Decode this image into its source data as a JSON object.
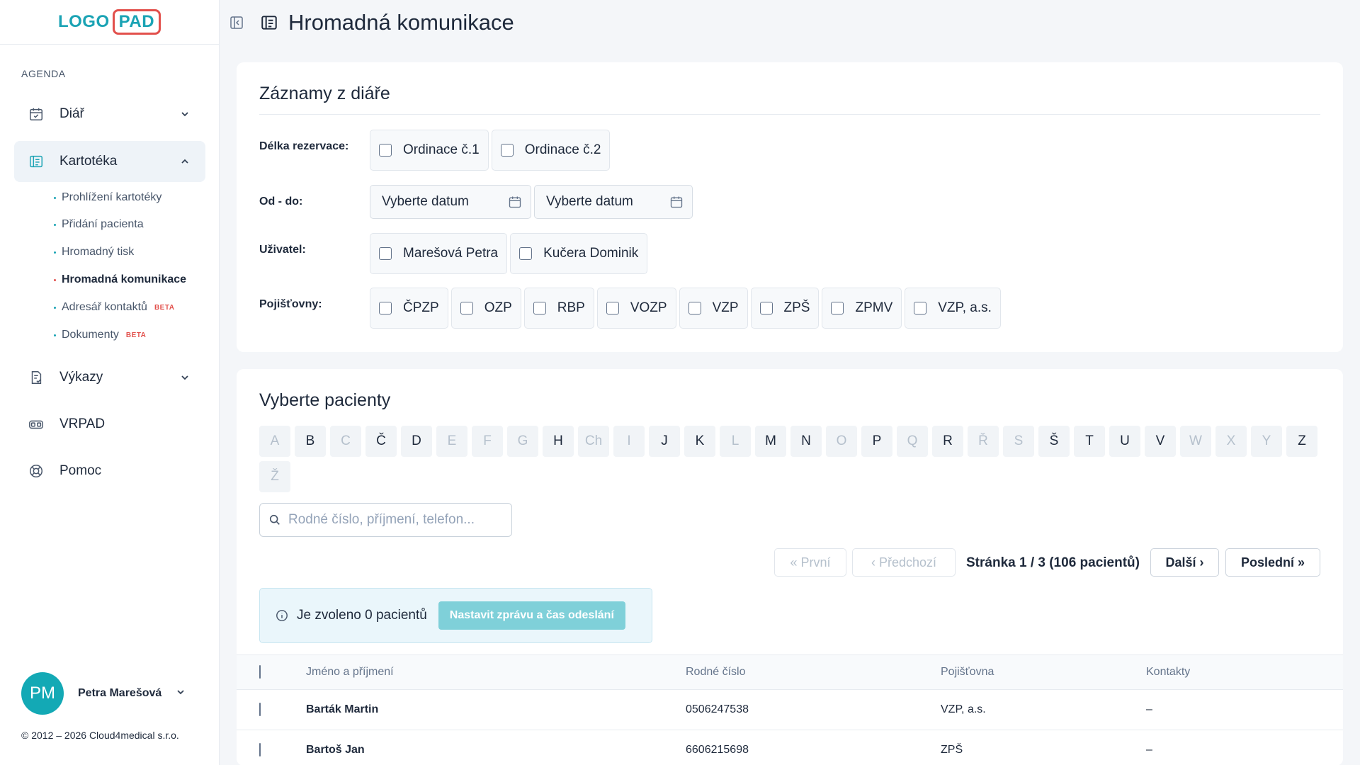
{
  "logo": {
    "part1": "LOGO",
    "part2": "PAD"
  },
  "sidebar": {
    "section": "AGENDA",
    "items": [
      {
        "label": "Diář",
        "icon": "calendar-icon"
      },
      {
        "label": "Kartotéka",
        "icon": "cards-icon"
      },
      {
        "label": "Výkazy",
        "icon": "report-icon"
      },
      {
        "label": "VRPAD",
        "icon": "vr-icon"
      },
      {
        "label": "Pomoc",
        "icon": "help-icon"
      }
    ],
    "subitems": [
      {
        "label": "Prohlížení kartotéky"
      },
      {
        "label": "Přidání pacienta"
      },
      {
        "label": "Hromadný tisk"
      },
      {
        "label": "Hromadná komunikace"
      },
      {
        "label": "Adresář kontaktů",
        "badge": "BETA"
      },
      {
        "label": "Dokumenty",
        "badge": "BETA"
      }
    ]
  },
  "user": {
    "initials": "PM",
    "name": "Petra Marešová"
  },
  "copyright": "© 2012 – 2026 Cloud4medical s.r.o.",
  "header": {
    "title": "Hromadná komunikace"
  },
  "records": {
    "title": "Záznamy z diáře",
    "length_label": "Délka rezervace:",
    "rooms": [
      "Ordinace č.1",
      "Ordinace č.2"
    ],
    "range_label": "Od - do:",
    "date_from_placeholder": "Vyberte datum",
    "date_to_placeholder": "Vyberte datum",
    "user_label": "Uživatel:",
    "users": [
      "Marešová Petra",
      "Kučera Dominik"
    ],
    "insurance_label": "Pojišťovny:",
    "insurances": [
      "ČPZP",
      "OZP",
      "RBP",
      "VOZP",
      "VZP",
      "ZPŠ",
      "ZPMV",
      "VZP, a.s."
    ]
  },
  "patients": {
    "title": "Vyberte pacienty",
    "letters": [
      {
        "l": "A",
        "enabled": false
      },
      {
        "l": "B",
        "enabled": true
      },
      {
        "l": "C",
        "enabled": false
      },
      {
        "l": "Č",
        "enabled": true
      },
      {
        "l": "D",
        "enabled": true
      },
      {
        "l": "E",
        "enabled": false
      },
      {
        "l": "F",
        "enabled": false
      },
      {
        "l": "G",
        "enabled": false
      },
      {
        "l": "H",
        "enabled": true
      },
      {
        "l": "Ch",
        "enabled": false
      },
      {
        "l": "I",
        "enabled": false
      },
      {
        "l": "J",
        "enabled": true
      },
      {
        "l": "K",
        "enabled": true
      },
      {
        "l": "L",
        "enabled": false
      },
      {
        "l": "M",
        "enabled": true
      },
      {
        "l": "N",
        "enabled": true
      },
      {
        "l": "O",
        "enabled": false
      },
      {
        "l": "P",
        "enabled": true
      },
      {
        "l": "Q",
        "enabled": false
      },
      {
        "l": "R",
        "enabled": true
      },
      {
        "l": "Ř",
        "enabled": false
      },
      {
        "l": "S",
        "enabled": false
      },
      {
        "l": "Š",
        "enabled": true
      },
      {
        "l": "T",
        "enabled": true
      },
      {
        "l": "U",
        "enabled": true
      },
      {
        "l": "V",
        "enabled": true
      },
      {
        "l": "W",
        "enabled": false
      },
      {
        "l": "X",
        "enabled": false
      },
      {
        "l": "Y",
        "enabled": false
      },
      {
        "l": "Z",
        "enabled": true
      },
      {
        "l": "Ž",
        "enabled": false
      }
    ],
    "search_placeholder": "Rodné číslo, příjmení, telefon...",
    "pager": {
      "first": "« První",
      "prev": "‹ Předchozí",
      "info": "Stránka 1 / 3 (106 pacientů)",
      "next": "Další ›",
      "last": "Poslední »"
    },
    "selected_info": "Je zvoleno 0 pacientů",
    "set_message_button": "Nastavit zprávu a čas odeslání",
    "columns": [
      "Jméno a příjmení",
      "Rodné číslo",
      "Pojišťovna",
      "Kontakty"
    ],
    "rows": [
      {
        "name": "Barták Martin",
        "rc": "0506247538",
        "insurance": "VZP, a.s.",
        "contacts": "–"
      },
      {
        "name": "Bartoš Jan",
        "rc": "6606215698",
        "insurance": "ZPŠ",
        "contacts": "–"
      }
    ]
  }
}
